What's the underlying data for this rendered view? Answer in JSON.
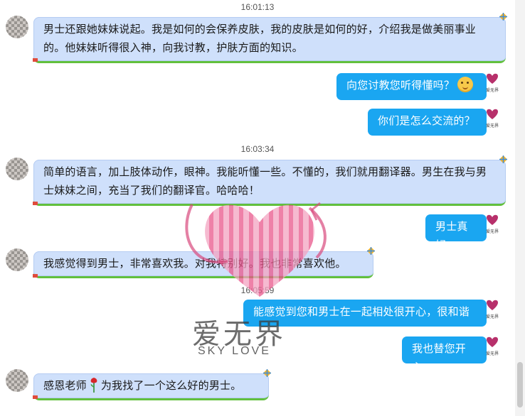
{
  "timestamps": [
    "16:01:13",
    "16:03:34",
    "16:05:59"
  ],
  "messages": [
    {
      "side": "in",
      "text": "男士还跟她妹妹说起。我是如何的会保养皮肤，我的皮肤是如何的好，介绍我是做美丽事业的。他妹妹听得很入神，向我讨教，护肤方面的知识。"
    },
    {
      "side": "out",
      "text": "向您讨教您听得懂吗？"
    },
    {
      "side": "out",
      "text": "你们是怎么交流的？"
    },
    {
      "side": "in",
      "text": "简单的语言，加上肢体动作，眼神。我能听懂一些。不懂的，我们就用翻译器。男生在我与男士妹妹之间，充当了我们的翻译官。哈哈哈！"
    },
    {
      "side": "out",
      "text": "男士真好"
    },
    {
      "side": "in",
      "text": "我感觉得到男士，非常喜欢我。对我特别好。我也非常喜欢他。"
    },
    {
      "side": "out",
      "text": "能感觉到您和男士在一起相处很开心，很和谐"
    },
    {
      "side": "out",
      "text": "我也替您开心"
    },
    {
      "side": "in",
      "text_before": "感恩老师",
      "text_after": "为我找了一个这么好的男士。"
    }
  ],
  "watermark": {
    "title": "爱无界",
    "subtitle": "SKY LOVE"
  },
  "avatar_label": "爱无界",
  "icons": {
    "emoji": "thinking-emoji-icon",
    "rose": "rose-icon",
    "kite": "kite-icon"
  },
  "colors": {
    "incoming_bubble": "#cfe0fb",
    "outgoing_bubble": "#1aa6f1",
    "incoming_underline": "#62c03d",
    "watermark_heart": "#e8578b"
  }
}
